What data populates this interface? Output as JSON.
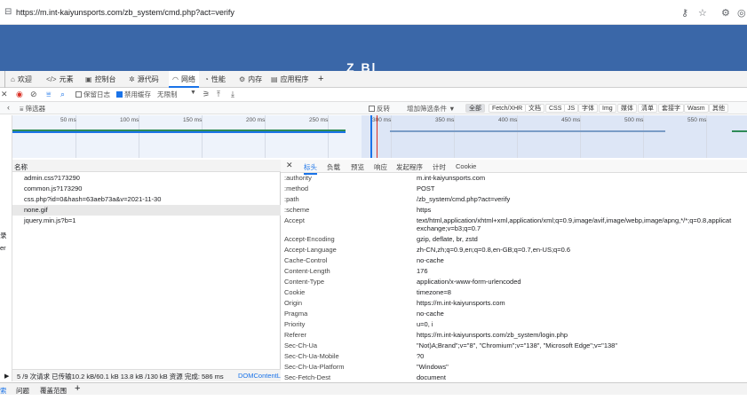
{
  "browser": {
    "url": "https://m.int-kaiyunsports.com/zb_system/cmd.php?act=verify"
  },
  "banner": {
    "logo_text": "Z Bl"
  },
  "devtools_tabs": [
    {
      "label": "欢迎"
    },
    {
      "label": "元素"
    },
    {
      "label": "控制台"
    },
    {
      "label": "源代码"
    },
    {
      "label": "网络"
    },
    {
      "label": "性能"
    },
    {
      "label": "内存"
    },
    {
      "label": "应用程序"
    }
  ],
  "toolbar": {
    "preserve_log": "保留日志",
    "disable_cache": "禁用缓存",
    "throttle": "无限制"
  },
  "filter": {
    "placeholder": "筛选器",
    "invert": "反转",
    "more_filters": "增加筛选条件",
    "types": [
      "全部",
      "Fetch/XHR",
      "文档",
      "CSS",
      "JS",
      "字体",
      "Img",
      "媒体",
      "清单",
      "套接字",
      "Wasm",
      "其他"
    ]
  },
  "timeline_ticks": [
    "50 ms",
    "100 ms",
    "150 ms",
    "200 ms",
    "250 ms",
    "300 ms",
    "350 ms",
    "400 ms",
    "450 ms",
    "500 ms",
    "550 ms"
  ],
  "list": {
    "header": "名称",
    "rows": [
      "admin.css?173290",
      "common.js?173290",
      "css.php?id=0&hash=63aeb73a&v=2021-11-30",
      "none.gif",
      "jquery.min.js?b=1"
    ]
  },
  "status": {
    "text": "5 /9 次请求  已传输10.2 kB/60.1 kB  13.8 kB /130 kB 资源  完成: 586 ms",
    "link": "DOMContentL"
  },
  "panel_tabs": [
    "标头",
    "负载",
    "预览",
    "响应",
    "发起程序",
    "计时",
    "Cookie"
  ],
  "headers": [
    {
      "name": ":authority",
      "value": "m.int-kaiyunsports.com"
    },
    {
      "name": ":method",
      "value": "POST"
    },
    {
      "name": ":path",
      "value": "/zb_system/cmd.php?act=verify"
    },
    {
      "name": ":scheme",
      "value": "https"
    },
    {
      "name": "Accept",
      "value": "text/html,application/xhtml+xml,application/xml;q=0.9,image/avif,image/webp,image/apng,*/*;q=0.8,applicat",
      "value2": "exchange;v=b3;q=0.7"
    },
    {
      "name": "Accept-Encoding",
      "value": "gzip, deflate, br, zstd"
    },
    {
      "name": "Accept-Language",
      "value": "zh-CN,zh;q=0.9,en;q=0.8,en-GB;q=0.7,en-US;q=0.6"
    },
    {
      "name": "Cache-Control",
      "value": "no-cache"
    },
    {
      "name": "Content-Length",
      "value": "176"
    },
    {
      "name": "Content-Type",
      "value": "application/x-www-form-urlencoded"
    },
    {
      "name": "Cookie",
      "value": "timezone=8"
    },
    {
      "name": "Origin",
      "value": "https://m.int-kaiyunsports.com"
    },
    {
      "name": "Pragma",
      "value": "no-cache"
    },
    {
      "name": "Priority",
      "value": "u=0, i"
    },
    {
      "name": "Referer",
      "value": "https://m.int-kaiyunsports.com/zb_system/login.php"
    },
    {
      "name": "Sec-Ch-Ua",
      "value": "\"Not)A;Brand\";v=\"8\", \"Chromium\";v=\"138\", \"Microsoft Edge\";v=\"138\""
    },
    {
      "name": "Sec-Ch-Ua-Mobile",
      "value": "?0"
    },
    {
      "name": "Sec-Ch-Ua-Platform",
      "value": "\"Windows\""
    },
    {
      "name": "Sec-Fetch-Dest",
      "value": "document"
    }
  ],
  "drawer_tabs": [
    "索",
    "问题",
    "覆盖范围"
  ],
  "left_strip": [
    "录",
    "er"
  ]
}
